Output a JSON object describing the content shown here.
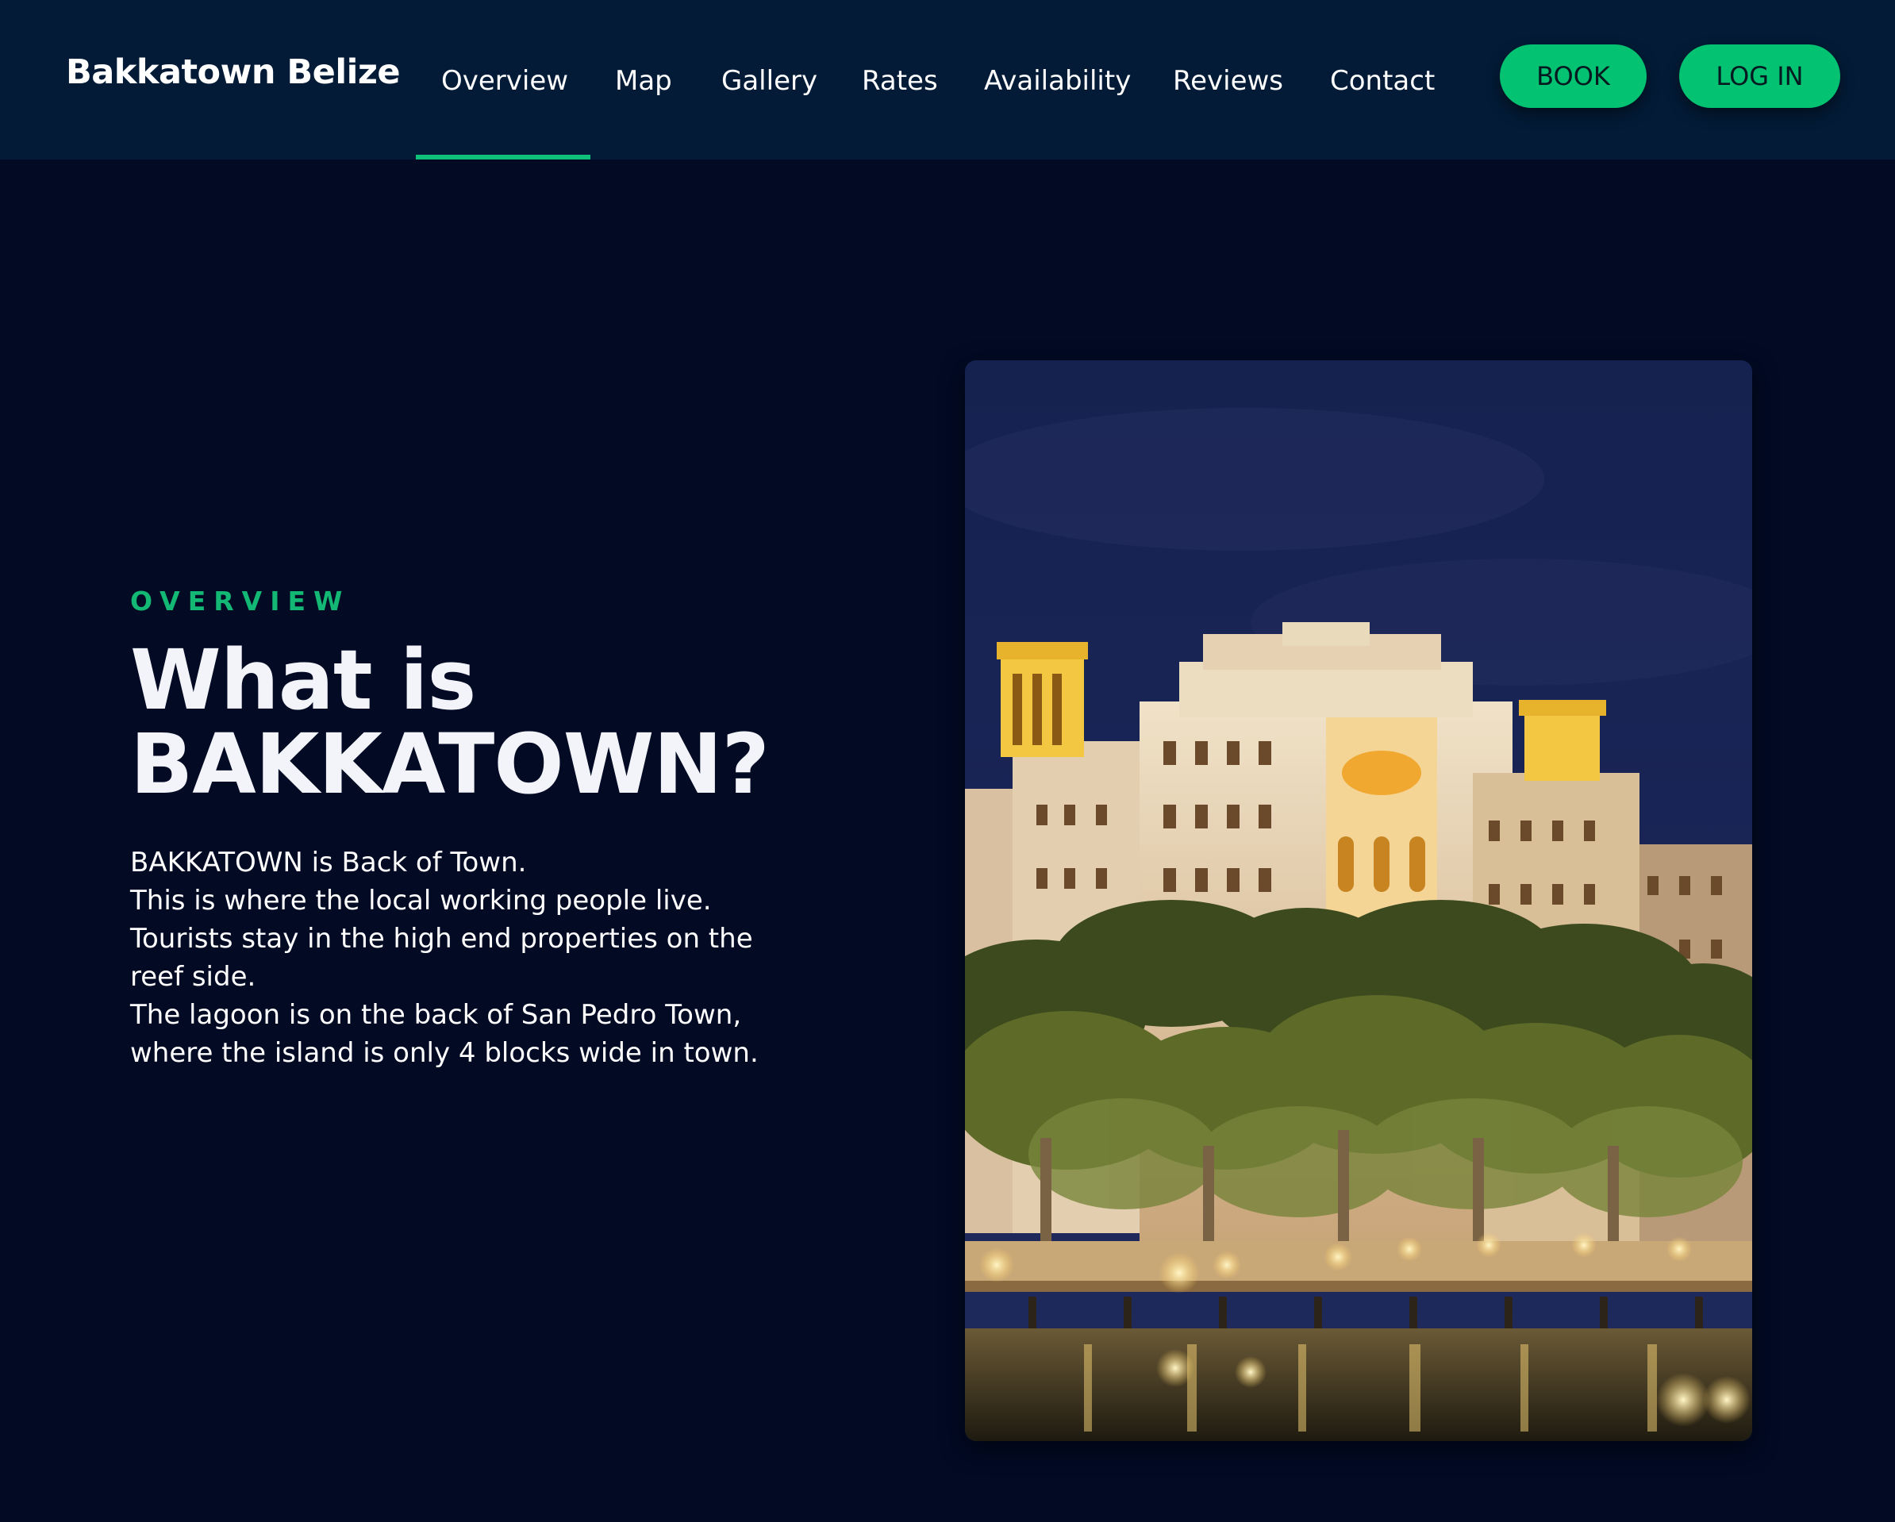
{
  "header": {
    "brand": "Bakkatown Belize",
    "nav": [
      {
        "label": "Overview",
        "active": true
      },
      {
        "label": "Map",
        "active": false
      },
      {
        "label": "Gallery",
        "active": false
      },
      {
        "label": "Rates",
        "active": false
      },
      {
        "label": "Availability",
        "active": false
      },
      {
        "label": "Reviews",
        "active": false
      },
      {
        "label": "Contact",
        "active": false
      }
    ],
    "book_label": "BOOK",
    "login_label": "LOG IN"
  },
  "overview": {
    "eyebrow": "OVERVIEW",
    "title_line1": "What is",
    "title_line2": "BAKKATOWN?",
    "body_lines": [
      "BAKKATOWN is Back of Town.",
      "This is where the local working people live.",
      "Tourists stay in the high end properties on the",
      "reef side.",
      "The lagoon is on the back of San Pedro Town,",
      "where the island is only 4 blocks wide in town."
    ]
  },
  "colors": {
    "page_background": "#020a24",
    "header_background": "#031b36",
    "accent": "#03c271",
    "eyebrow": "#12b873"
  }
}
